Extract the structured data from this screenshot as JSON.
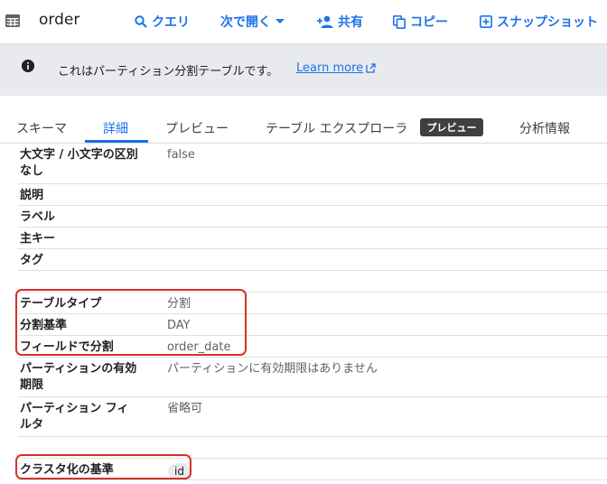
{
  "toolbar": {
    "title": "order",
    "query_label": "クエリ",
    "open_in_label": "次で開く",
    "share_label": "共有",
    "copy_label": "コピー",
    "snapshot_label": "スナップショット"
  },
  "banner": {
    "message": "これはパーティション分割テーブルです。",
    "link_label": "Learn more"
  },
  "tabs": [
    {
      "label": "スキーマ"
    },
    {
      "label": "詳細"
    },
    {
      "label": "プレビュー"
    },
    {
      "label": "テーブル エクスプローラ"
    },
    {
      "label": "分析情報"
    }
  ],
  "tab_badge": "プレビュー",
  "details": {
    "case_insensitive": {
      "label_line1": "大文字 / 小文字の区別",
      "label_line2": "なし",
      "value": "false"
    },
    "description": {
      "label": "説明",
      "value": ""
    },
    "labels": {
      "label": "ラベル",
      "value": ""
    },
    "primary_key": {
      "label": "主キー",
      "value": ""
    },
    "tags": {
      "label": "タグ",
      "value": ""
    },
    "table_type": {
      "label": "テーブルタイプ",
      "value": "分割"
    },
    "partitioned_by": {
      "label": "分割基準",
      "value": "DAY"
    },
    "partitioned_on_field": {
      "label": "フィールドで分割",
      "value": "order_date"
    },
    "partition_expiration": {
      "label_line1": "パーティションの有効",
      "label_line2": "期限",
      "value": "パーティションに有効期限はありません"
    },
    "partition_filter": {
      "label_line1": "パーティション フィ",
      "label_line2": "ルタ",
      "value": "省略可"
    },
    "clustered_by": {
      "label": "クラスタ化の基準",
      "chip": "id"
    }
  },
  "colors": {
    "accent": "#1a73e8",
    "highlight": "#d93025",
    "banner_bg": "#e8eaed"
  }
}
